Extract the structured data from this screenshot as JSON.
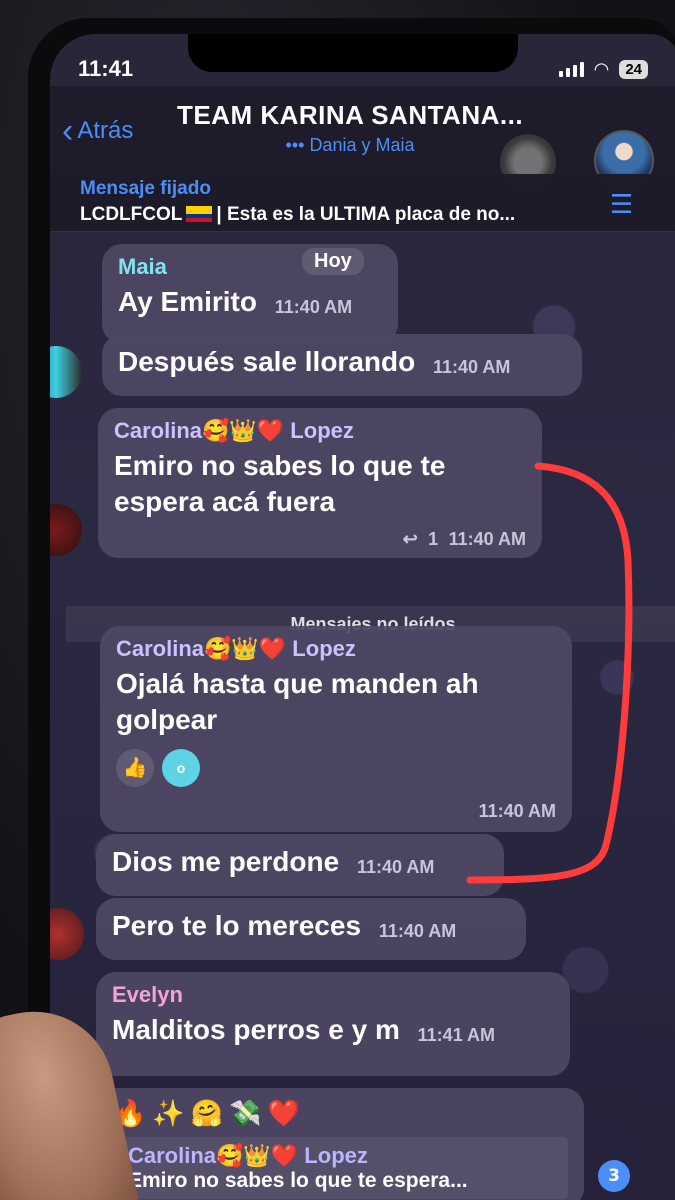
{
  "status_bar": {
    "time": "11:41",
    "battery": "24"
  },
  "header": {
    "back_label": "Atrás",
    "title": "TEAM KARINA SANTANA...",
    "typing": "Dania y Maia"
  },
  "pinned": {
    "label": "Mensaje fijado",
    "prefix": "LCDLFCOL",
    "text": "| Esta es la ULTIMA placa de no..."
  },
  "date_badge": "Hoy",
  "unread_separator": "Mensajes no leídos",
  "messages": [
    {
      "sender": "Maia",
      "sender_color": "#7fe3f0",
      "text": "Ay Emirito",
      "time": "11:40 AM"
    },
    {
      "sender": "",
      "text": "Después sale llorando",
      "time": "11:40 AM"
    },
    {
      "sender": "Carolina🥰👑❤️ Lopez",
      "sender_color": "#c9c3ff",
      "text": "Emiro no sabes lo que te espera acá fuera",
      "replies": "1",
      "time": "11:40 AM"
    },
    {
      "sender": "Carolina🥰👑❤️ Lopez",
      "sender_color": "#c9c3ff",
      "text": "Ojalá hasta que manden ah golpear",
      "reaction": "👍",
      "time": "11:40 AM"
    },
    {
      "sender": "",
      "text": "Dios me perdone",
      "time": "11:40 AM"
    },
    {
      "sender": "",
      "text": "Pero te lo mereces",
      "time": "11:40 AM"
    },
    {
      "sender": "Evelyn",
      "sender_color": "#f2a3d8",
      "text": "Malditos perros e y m",
      "time": "11:41 AM"
    },
    {
      "emoji_header": "🔥✨🤗💸❤️",
      "quote_sender": "Carolina🥰👑❤️ Lopez",
      "quote_text": "Emiro no sabes lo que te espera..."
    }
  ],
  "unread_badge": "3",
  "colors": {
    "accent": "#4c8df6",
    "annotation": "#ff3b3b",
    "bubble": "#4e4864"
  }
}
